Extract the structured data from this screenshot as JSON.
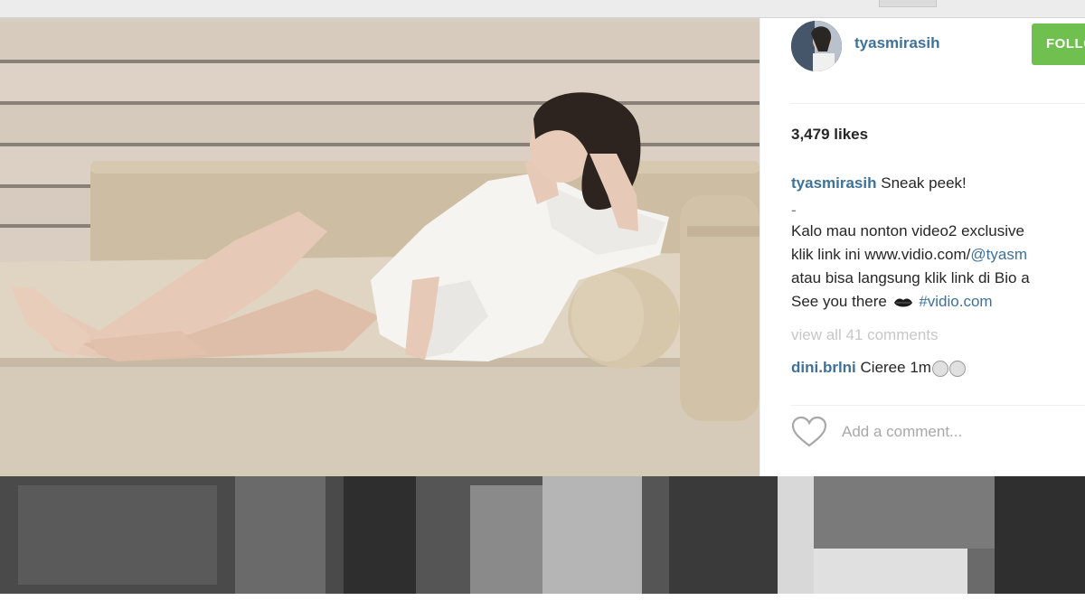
{
  "post": {
    "username": "tyasmirasih",
    "follow_label": "FOLLOW",
    "likes": "3,479 likes",
    "caption": {
      "user": "tyasmirasih",
      "text": "Sneak peek!",
      "dash": "-",
      "line2": "Kalo mau nonton video2 exclusive",
      "line3_prefix": "klik link ini www.vidio.com/",
      "line3_link": "@tyasm",
      "line4": "atau bisa langsung klik link di Bio a",
      "line5_prefix": "See you there",
      "line5_hashtag": "#vidio.com"
    },
    "view_all_comments": "view all 41 comments",
    "comments": [
      {
        "user": "dini.brlni",
        "text": "Cieree 1m"
      }
    ],
    "add_comment_placeholder": "Add a comment...",
    "heart_icon": "heart-outline-icon"
  },
  "colors": {
    "username": "#3f729b",
    "follow_button": "#70c050",
    "text": "#262626",
    "muted": "#c7c7c7"
  }
}
